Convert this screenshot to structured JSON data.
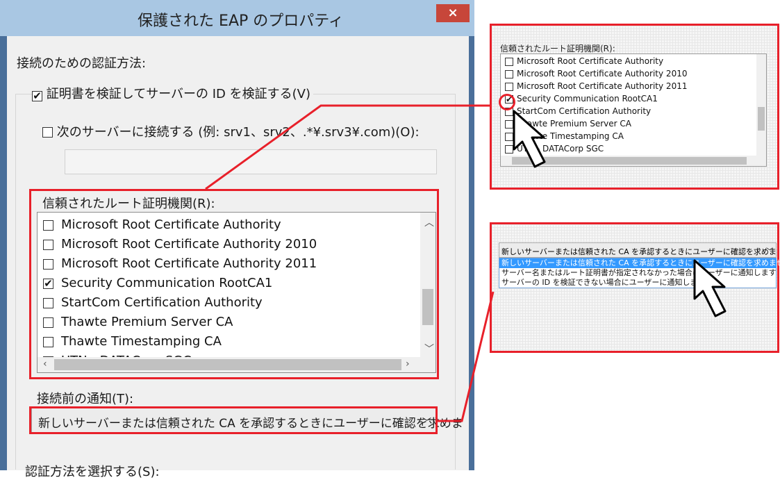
{
  "dialog": {
    "title": "保護された EAP のプロパティ",
    "close_glyph": "×",
    "auth_method_label": "接続のための認証方法:",
    "verify_cert_label": "証明書を検証してサーバーの ID を検証する(V)",
    "verify_cert_checked": true,
    "connect_servers_label": "次のサーバーに接続する (例: srv1、srv2、.*¥.srv3¥.com)(O):",
    "connect_servers_checked": false,
    "server_input_value": "",
    "trusted_ca_label": "信頼されたルート証明機関(R):",
    "trusted_ca_items": [
      {
        "label": "Microsoft Root Certificate Authority",
        "checked": false
      },
      {
        "label": "Microsoft Root Certificate Authority 2010",
        "checked": false
      },
      {
        "label": "Microsoft Root Certificate Authority 2011",
        "checked": false
      },
      {
        "label": "Security Communication RootCA1",
        "checked": true
      },
      {
        "label": "StartCom Certification Authority",
        "checked": false
      },
      {
        "label": "Thawte Premium Server CA",
        "checked": false
      },
      {
        "label": "Thawte Timestamping CA",
        "checked": false
      },
      {
        "label": "UTN - DATACorp SGC",
        "checked": false
      }
    ],
    "notify_label": "接続前の通知(T):",
    "notify_selected": "新しいサーバーまたは信頼された CA を承認するときにユーザーに確認を求めま",
    "select_method_label": "認証方法を選択する(S):"
  },
  "zoom_list": {
    "label": "信頼されたルート証明機関(R):",
    "items": [
      {
        "label": "Microsoft Root Certificate Authority",
        "checked": false
      },
      {
        "label": "Microsoft Root Certificate Authority 2010",
        "checked": false
      },
      {
        "label": "Microsoft Root Certificate Authority 2011",
        "checked": false
      },
      {
        "label": "Security Communication RootCA1",
        "checked": true
      },
      {
        "label": "StartCom Certification Authority",
        "checked": false
      },
      {
        "label": "Thawte Premium Server CA",
        "checked": false
      },
      {
        "label": "Thawte Timestamping CA",
        "checked": false
      },
      {
        "label": "UTN - DATACorp SGC",
        "checked": false
      }
    ]
  },
  "zoom_dropdown": {
    "selected": "新しいサーバーまたは信頼された CA を承認するときにユーザーに確認を求めま",
    "options": [
      "新しいサーバーまたは信頼された CA を承認するときにユーザーに確認を求めません",
      "サーバー名またはルート証明書が指定されなかった場合にユーザーに通知します",
      "サーバーの ID を検証できない場合にユーザーに通知します"
    ]
  },
  "colors": {
    "highlight": "#e8202a",
    "titlebar": "#a9c7e3",
    "close": "#c7463a",
    "selection": "#3399ff"
  }
}
